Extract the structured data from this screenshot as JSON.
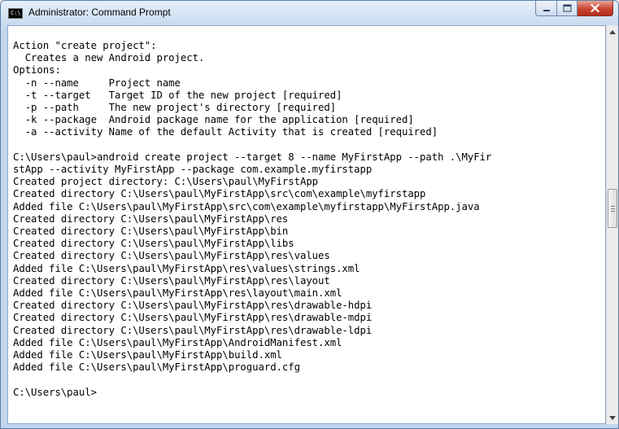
{
  "window": {
    "title": "Administrator: Command Prompt",
    "icon_text": "C:\\",
    "buttons": {
      "minimize": "minimize",
      "maximize": "maximize",
      "close": "close"
    }
  },
  "console": {
    "lines": [
      "Action \"create project\":",
      "  Creates a new Android project.",
      "Options:",
      "  -n --name     Project name",
      "  -t --target   Target ID of the new project [required]",
      "  -p --path     The new project's directory [required]",
      "  -k --package  Android package name for the application [required]",
      "  -a --activity Name of the default Activity that is created [required]",
      "",
      "C:\\Users\\paul>android create project --target 8 --name MyFirstApp --path .\\MyFir",
      "stApp --activity MyFirstApp --package com.example.myfirstapp",
      "Created project directory: C:\\Users\\paul\\MyFirstApp",
      "Created directory C:\\Users\\paul\\MyFirstApp\\src\\com\\example\\myfirstapp",
      "Added file C:\\Users\\paul\\MyFirstApp\\src\\com\\example\\myfirstapp\\MyFirstApp.java",
      "Created directory C:\\Users\\paul\\MyFirstApp\\res",
      "Created directory C:\\Users\\paul\\MyFirstApp\\bin",
      "Created directory C:\\Users\\paul\\MyFirstApp\\libs",
      "Created directory C:\\Users\\paul\\MyFirstApp\\res\\values",
      "Added file C:\\Users\\paul\\MyFirstApp\\res\\values\\strings.xml",
      "Created directory C:\\Users\\paul\\MyFirstApp\\res\\layout",
      "Added file C:\\Users\\paul\\MyFirstApp\\res\\layout\\main.xml",
      "Created directory C:\\Users\\paul\\MyFirstApp\\res\\drawable-hdpi",
      "Created directory C:\\Users\\paul\\MyFirstApp\\res\\drawable-mdpi",
      "Created directory C:\\Users\\paul\\MyFirstApp\\res\\drawable-ldpi",
      "Added file C:\\Users\\paul\\MyFirstApp\\AndroidManifest.xml",
      "Added file C:\\Users\\paul\\MyFirstApp\\build.xml",
      "Added file C:\\Users\\paul\\MyFirstApp\\proguard.cfg",
      "",
      "C:\\Users\\paul>"
    ]
  },
  "scrollbar": {
    "position_fraction": 0.45
  },
  "icons": [
    "console-app-icon",
    "minimize-icon",
    "maximize-icon",
    "close-icon",
    "scroll-up-arrow-icon",
    "scroll-down-arrow-icon"
  ]
}
